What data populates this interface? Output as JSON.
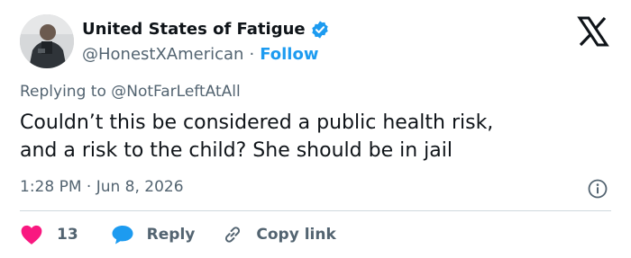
{
  "tweet": {
    "display_name": "United States of Fatigue",
    "handle": "@HonestXAmerican",
    "separator": "·",
    "follow_label": "Follow",
    "replying_prefix": "Replying to",
    "replying_to": "@NotFarLeftAtAll",
    "text_lines": [
      "Couldn’t this be considered a public health risk,",
      "and a risk to the child? She should be in jail"
    ],
    "timestamp": "1:28 PM · Jun 8, 2026",
    "like_count": "13",
    "reply_label": "Reply",
    "copy_link_label": "Copy link"
  },
  "icons": {
    "avatar": "profile-photo",
    "verified": "verified-badge-icon",
    "logo": "x-logo-icon",
    "info": "info-icon",
    "like": "heart-icon",
    "reply": "speech-bubble-icon",
    "copy": "link-icon"
  },
  "colors": {
    "text": "#0f1419",
    "secondary": "#536471",
    "accent": "#1d9bf0",
    "like": "#f91880",
    "divider": "#cfd9de"
  }
}
